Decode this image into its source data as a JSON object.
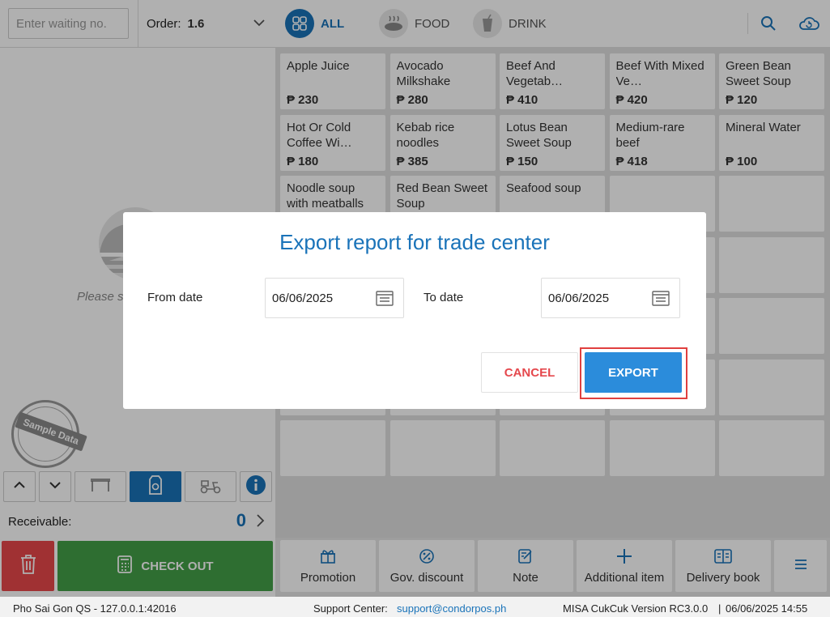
{
  "left": {
    "waiting_placeholder": "Enter waiting no.",
    "order_label": "Order:",
    "order_value": "1.6",
    "empty_text": "Please s",
    "stamp_text": "Sample Data",
    "receivable_label": "Receivable:",
    "receivable_value": "0",
    "checkout_label": "CHECK OUT"
  },
  "categories": [
    {
      "label": "ALL",
      "icon": "grid-icon",
      "active": true
    },
    {
      "label": "FOOD",
      "icon": "food-icon",
      "active": false
    },
    {
      "label": "DRINK",
      "icon": "drink-icon",
      "active": false
    }
  ],
  "items": [
    {
      "name": "Apple Juice",
      "price": "₱ 230"
    },
    {
      "name": "Avocado Milkshake",
      "price": "₱ 280"
    },
    {
      "name": "Beef And Vegetab…",
      "price": "₱ 410"
    },
    {
      "name": "Beef With Mixed Ve…",
      "price": "₱ 420"
    },
    {
      "name": "Green Bean Sweet Soup",
      "price": "₱ 120"
    },
    {
      "name": "Hot Or Cold Coffee Wi…",
      "price": "₱ 180"
    },
    {
      "name": "Kebab rice noodles",
      "price": "₱ 385"
    },
    {
      "name": "Lotus Bean Sweet Soup",
      "price": "₱ 150"
    },
    {
      "name": "Medium-rare beef",
      "price": "₱ 418"
    },
    {
      "name": "Mineral Water",
      "price": "₱ 100"
    },
    {
      "name": "Noodle soup with meatballs",
      "price": ""
    },
    {
      "name": "Red Bean Sweet Soup",
      "price": ""
    },
    {
      "name": "Seafood soup",
      "price": ""
    }
  ],
  "actions": [
    {
      "label": "Promotion",
      "icon": "gift-icon"
    },
    {
      "label": "Gov. discount",
      "icon": "discount-icon"
    },
    {
      "label": "Note",
      "icon": "note-icon"
    },
    {
      "label": "Additional item",
      "icon": "plus-icon"
    },
    {
      "label": "Delivery book",
      "icon": "book-icon"
    },
    {
      "label": "",
      "icon": "menu-icon"
    }
  ],
  "status": {
    "left": "Pho Sai Gon QS - 127.0.0.1:42016",
    "support_label": "Support Center:",
    "support_link": "support@condorpos.ph",
    "version": "MISA CukCuk Version RC3.0.0",
    "datetime": "06/06/2025 14:55"
  },
  "dialog": {
    "title": "Export report for trade center",
    "from_label": "From date",
    "from_value": "06/06/2025",
    "to_label": "To date",
    "to_value": "06/06/2025",
    "cancel_label": "CANCEL",
    "export_label": "EXPORT"
  },
  "colors": {
    "accent": "#1a73b9",
    "checkout": "#43a047",
    "delete": "#e8484b",
    "cancel_text": "#e5484d",
    "export": "#2b8cdb",
    "highlight": "#e0403f"
  }
}
